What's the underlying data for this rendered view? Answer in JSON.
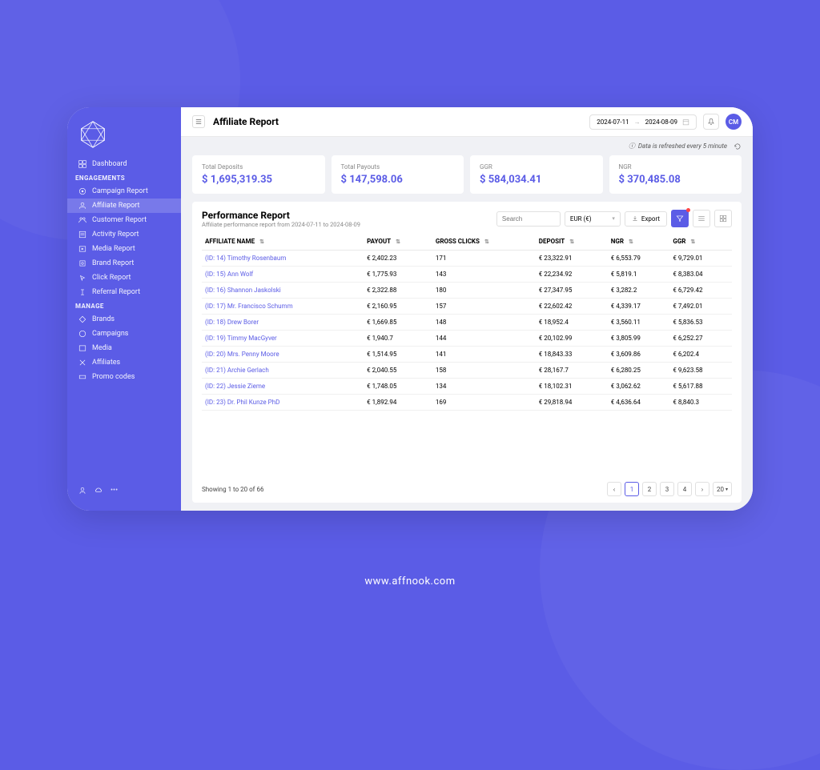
{
  "header": {
    "title": "Affiliate Report",
    "dateStart": "2024-07-11",
    "dateEnd": "2024-08-09",
    "avatar": "CM"
  },
  "refresh": {
    "text": "Data is refreshed every 5 minute"
  },
  "sidebar": {
    "dashboard": "Dashboard",
    "sectionEngagements": "ENGAGEMENTS",
    "campaignReport": "Campaign Report",
    "affiliateReport": "Affiliate Report",
    "customerReport": "Customer Report",
    "activityReport": "Activity Report",
    "mediaReport": "Media Report",
    "brandReport": "Brand Report",
    "clickReport": "Click Report",
    "referralReport": "Referral Report",
    "sectionManage": "MANAGE",
    "brands": "Brands",
    "campaigns": "Campaigns",
    "media": "Media",
    "affiliates": "Affiliates",
    "promoCodes": "Promo codes"
  },
  "stats": {
    "totalDepositsLabel": "Total Deposits",
    "totalDepositsValue": "$ 1,695,319.35",
    "totalPayoutsLabel": "Total Payouts",
    "totalPayoutsValue": "$ 147,598.06",
    "ggrLabel": "GGR",
    "ggrValue": "$ 584,034.41",
    "ngrLabel": "NGR",
    "ngrValue": "$ 370,485.08"
  },
  "report": {
    "title": "Performance Report",
    "subtitle": "Affiliate performance report from 2024-07-11 to 2024-08-09",
    "searchPlaceholder": "Search",
    "currency": "EUR (€)",
    "export": "Export",
    "columns": {
      "affiliateName": "AFFILIATE NAME",
      "payout": "PAYOUT",
      "grossClicks": "GROSS CLICKS",
      "deposit": "DEPOSIT",
      "ngr": "NGR",
      "ggr": "GGR"
    },
    "rows": [
      {
        "name": "(ID: 14) Timothy Rosenbaum",
        "payout": "€ 2,402.23",
        "clicks": "171",
        "deposit": "€ 23,322.91",
        "ngr": "€ 6,553.79",
        "ggr": "€ 9,729.01"
      },
      {
        "name": "(ID: 15) Ann Wolf",
        "payout": "€ 1,775.93",
        "clicks": "143",
        "deposit": "€ 22,234.92",
        "ngr": "€ 5,819.1",
        "ggr": "€ 8,383.04"
      },
      {
        "name": "(ID: 16) Shannon Jaskolski",
        "payout": "€ 2,322.88",
        "clicks": "180",
        "deposit": "€ 27,347.95",
        "ngr": "€ 3,282.2",
        "ggr": "€ 6,729.42"
      },
      {
        "name": "(ID: 17) Mr. Francisco Schumm",
        "payout": "€ 2,160.95",
        "clicks": "157",
        "deposit": "€ 22,602.42",
        "ngr": "€ 4,339.17",
        "ggr": "€ 7,492.01"
      },
      {
        "name": "(ID: 18) Drew Borer",
        "payout": "€ 1,669.85",
        "clicks": "148",
        "deposit": "€ 18,952.4",
        "ngr": "€ 3,560.11",
        "ggr": "€ 5,836.53"
      },
      {
        "name": "(ID: 19) Timmy MacGyver",
        "payout": "€ 1,940.7",
        "clicks": "144",
        "deposit": "€ 20,102.99",
        "ngr": "€ 3,805.99",
        "ggr": "€ 6,252.27"
      },
      {
        "name": "(ID: 20) Mrs. Penny Moore",
        "payout": "€ 1,514.95",
        "clicks": "141",
        "deposit": "€ 18,843.33",
        "ngr": "€ 3,609.86",
        "ggr": "€ 6,202.4"
      },
      {
        "name": "(ID: 21) Archie Gerlach",
        "payout": "€ 2,040.55",
        "clicks": "158",
        "deposit": "€ 28,167.7",
        "ngr": "€ 6,280.25",
        "ggr": "€ 9,623.58"
      },
      {
        "name": "(ID: 22) Jessie Zieme",
        "payout": "€ 1,748.05",
        "clicks": "134",
        "deposit": "€ 18,102.31",
        "ngr": "€ 3,062.62",
        "ggr": "€ 5,617.88"
      },
      {
        "name": "(ID: 23) Dr. Phil Kunze PhD",
        "payout": "€ 1,892.94",
        "clicks": "169",
        "deposit": "€ 29,818.94",
        "ngr": "€ 4,636.64",
        "ggr": "€ 8,840.3"
      }
    ],
    "footerText": "Showing 1 to 20 of 66",
    "pages": {
      "p1": "1",
      "p2": "2",
      "p3": "3",
      "p4": "4",
      "perPage": "20"
    }
  },
  "footer": {
    "site": "www.affnook.com"
  }
}
